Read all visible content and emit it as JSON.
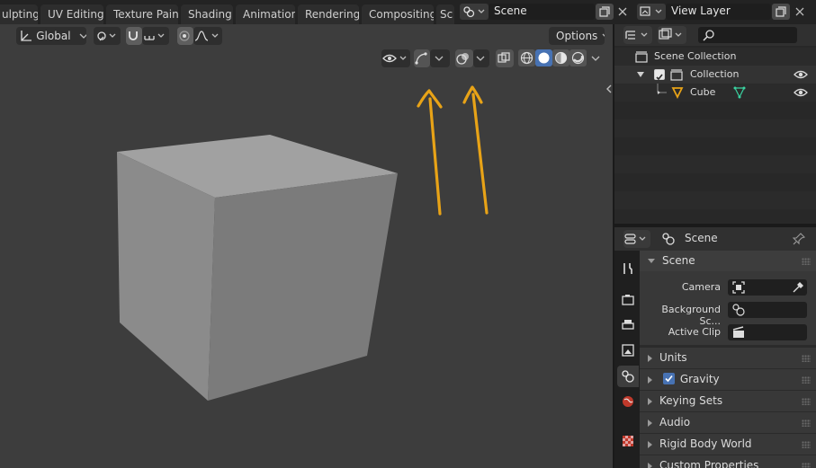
{
  "workspace_tabs": [
    "ulpting",
    "UV Editing",
    "Texture Paint",
    "Shading",
    "Animation",
    "Rendering",
    "Compositing",
    "Sc"
  ],
  "scene_selector": {
    "value": "Scene"
  },
  "view_layer_selector": {
    "value": "View Layer"
  },
  "viewport_header": {
    "orientation": "Global",
    "options_label": "Options"
  },
  "outliner": {
    "search_placeholder": "",
    "items": [
      {
        "label": "Scene Collection"
      },
      {
        "label": "Collection"
      },
      {
        "label": "Cube"
      }
    ]
  },
  "properties": {
    "context_label": "Scene",
    "scene_panel": {
      "title": "Scene",
      "camera_label": "Camera",
      "background_label": "Background Sc...",
      "active_clip_label": "Active Clip"
    },
    "subpanels": [
      {
        "label": "Units"
      },
      {
        "label": "Gravity",
        "checked": true
      },
      {
        "label": "Keying Sets"
      },
      {
        "label": "Audio"
      },
      {
        "label": "Rigid Body World"
      },
      {
        "label": "Custom Properties"
      }
    ]
  },
  "colors": {
    "viewport_bg": "#3d3d3d",
    "annotation_arrow": "#e8a317",
    "active_shading": "#4772b3",
    "mesh_icon": "#3ad2a0",
    "object_icon": "#e8a317"
  }
}
